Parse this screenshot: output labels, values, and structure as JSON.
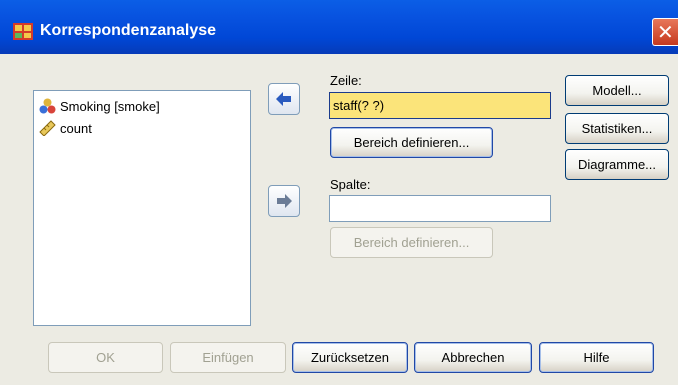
{
  "window": {
    "title": "Korrespondenzanalyse",
    "close_glyph": "✕"
  },
  "variables": [
    {
      "label": "Smoking [smoke]",
      "icon": "nominal-variable-icon"
    },
    {
      "label": "count",
      "icon": "scale-variable-icon"
    }
  ],
  "row_field": {
    "label": "Zeile:",
    "value": "staff(? ?)",
    "define_label": "Bereich definieren..."
  },
  "col_field": {
    "label": "Spalte:",
    "value": "",
    "define_label": "Bereich definieren..."
  },
  "side_buttons": {
    "model": "Modell...",
    "statistics": "Statistiken...",
    "plots": "Diagramme..."
  },
  "bottom_buttons": {
    "ok": "OK",
    "paste": "Einfügen",
    "reset": "Zurücksetzen",
    "cancel": "Abbrechen",
    "help": "Hilfe"
  },
  "colors": {
    "titlebar": "#0853e0",
    "selected_field": "#fbe47a",
    "dialog_bg": "#ecebe3"
  }
}
